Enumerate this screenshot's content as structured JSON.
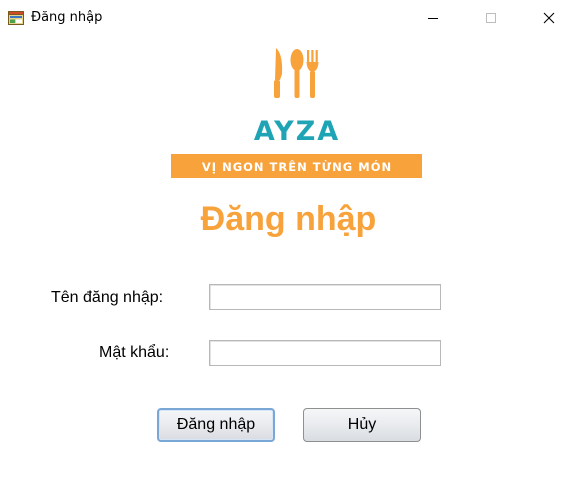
{
  "window": {
    "title": "Đăng nhập",
    "controls": [
      "minimize-icon",
      "maximize-icon",
      "close-icon"
    ]
  },
  "logo": {
    "brand": "AYZA",
    "tagline": "VỊ NGON TRÊN TỪNG MÓN",
    "colors": {
      "accent": "#f7a23b",
      "brand": "#1fa4b5",
      "banner_text": "#ffffff"
    }
  },
  "form": {
    "heading": "Đăng nhập",
    "username_label": "Tên đăng nhập:",
    "username_value": "",
    "password_label": "Mật khẩu:",
    "password_value": ""
  },
  "buttons": {
    "login_label": "Đăng nhập",
    "cancel_label": "Hủy"
  }
}
